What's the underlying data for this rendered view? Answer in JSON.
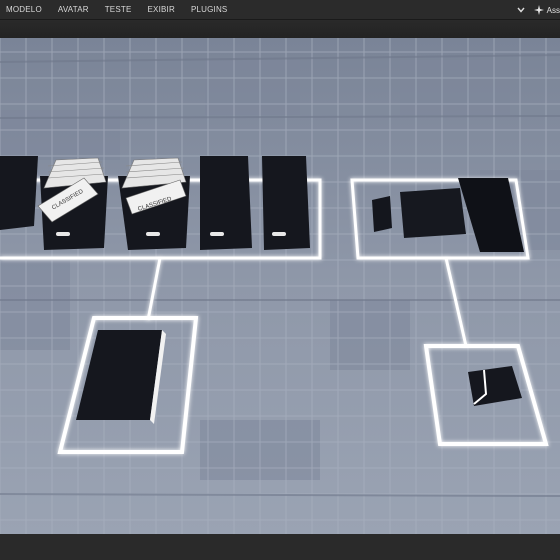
{
  "menu": {
    "items": [
      "MODELO",
      "AVATAR",
      "TESTE",
      "EXIBIR",
      "PLUGINS"
    ]
  },
  "assistant": {
    "label": "Ass"
  },
  "scene": {
    "classified_label": "CLASSIFIED",
    "colors": {
      "floor": "#8e97a8",
      "tile_dark": "#7f889b",
      "grid_line": "#a7afbe",
      "neon": "#ffffff",
      "box": "#15171e"
    }
  }
}
